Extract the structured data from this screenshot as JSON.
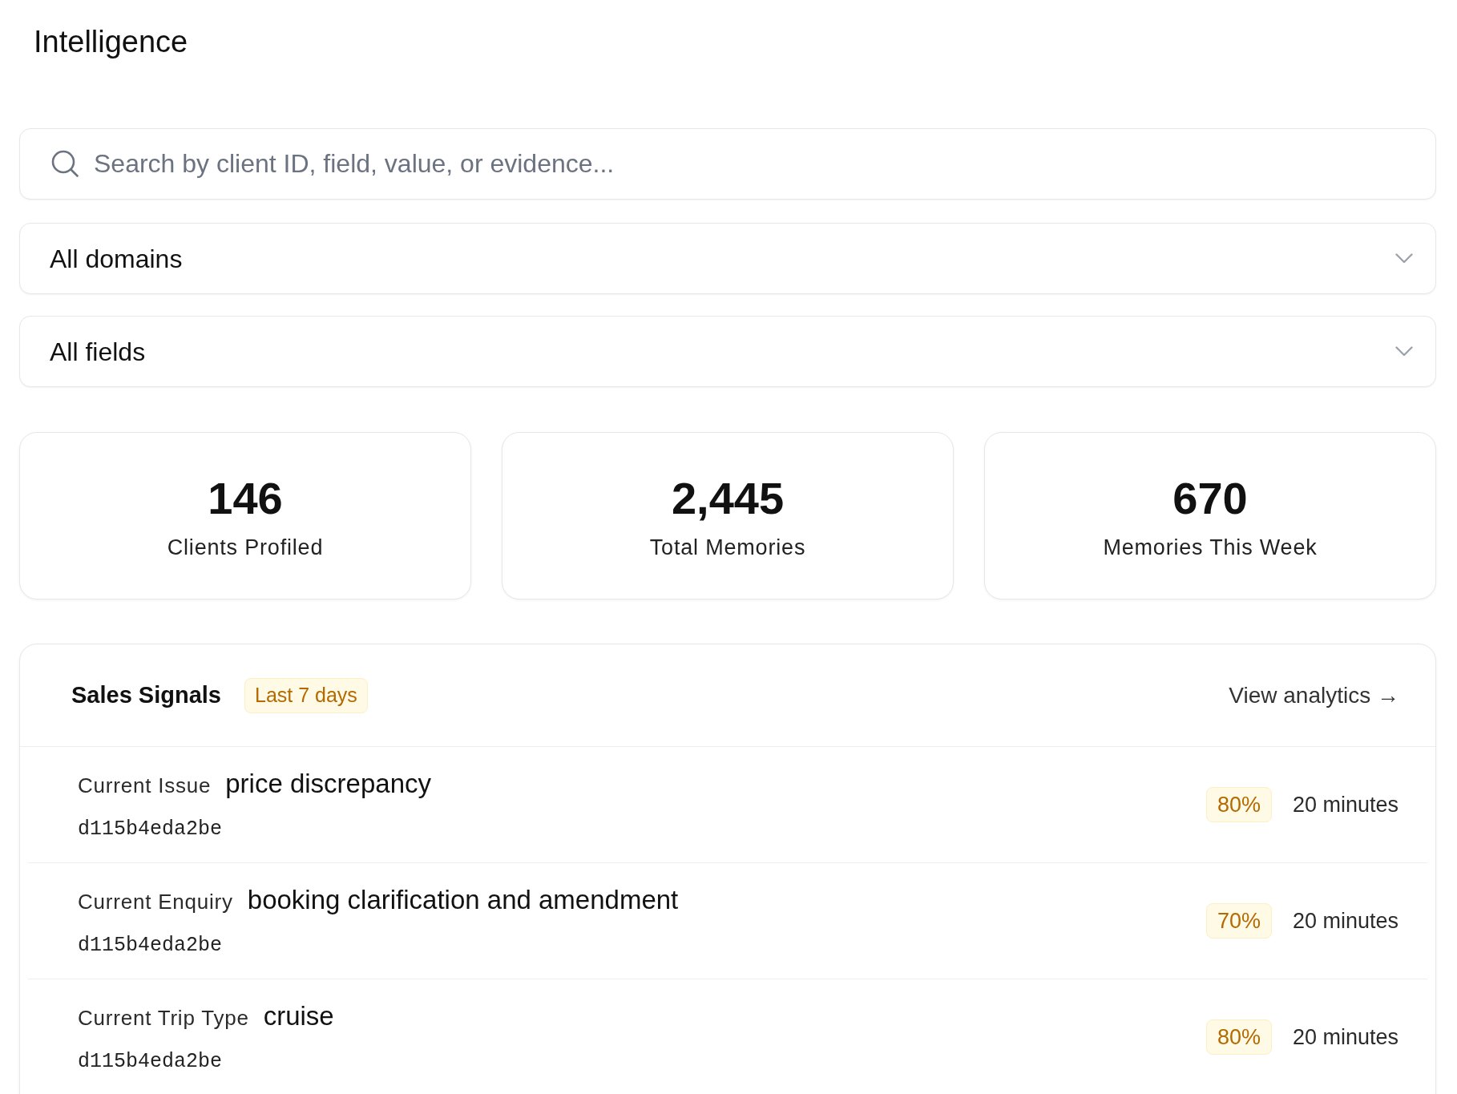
{
  "page_title": "Intelligence",
  "search": {
    "placeholder": "Search by client ID, field, value, or evidence..."
  },
  "filters": [
    {
      "value": "All domains"
    },
    {
      "value": "All fields"
    }
  ],
  "stats": [
    {
      "value": "146",
      "label": "Clients Profiled"
    },
    {
      "value": "2,445",
      "label": "Total Memories"
    },
    {
      "value": "670",
      "label": "Memories This Week"
    }
  ],
  "sales_signals": {
    "title": "Sales Signals",
    "badge": "Last 7 days",
    "link": "View analytics →",
    "rows": [
      {
        "field": "Current Issue",
        "value": "price discrepancy",
        "client_id": "d115b4eda2be",
        "confidence": "80%",
        "time": "20 minutes"
      },
      {
        "field": "Current Enquiry",
        "value": "booking clarification and amendment",
        "client_id": "d115b4eda2be",
        "confidence": "70%",
        "time": "20 minutes"
      },
      {
        "field": "Current Trip Type",
        "value": "cruise",
        "client_id": "d115b4eda2be",
        "confidence": "80%",
        "time": "20 minutes"
      }
    ]
  }
}
